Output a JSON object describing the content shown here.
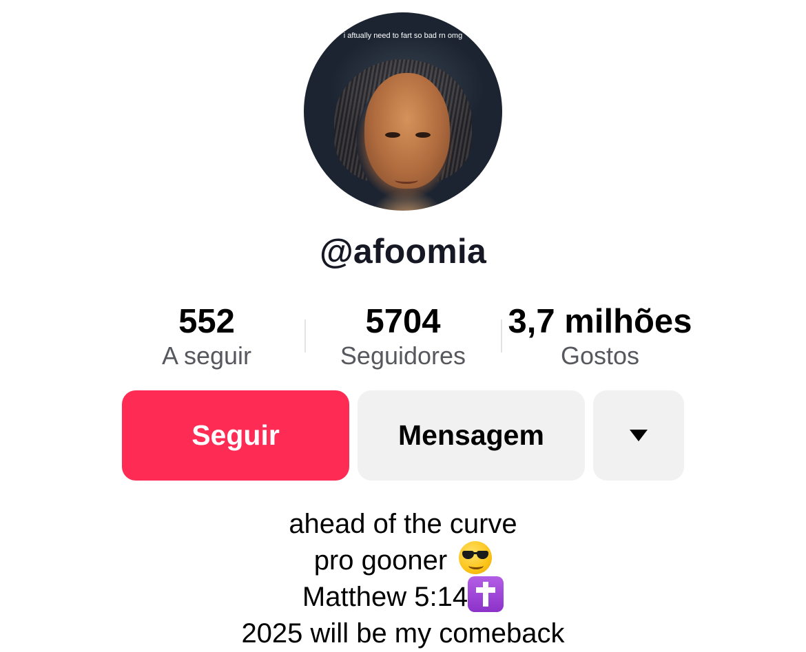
{
  "profile": {
    "avatar_caption": "i aftually need to fart so bad rn omg",
    "username": "@afoomia"
  },
  "stats": [
    {
      "value": "552",
      "label": "A seguir"
    },
    {
      "value": "5704",
      "label": "Seguidores"
    },
    {
      "value": "3,7 milhões",
      "label": "Gostos"
    }
  ],
  "actions": {
    "follow_label": "Seguir",
    "message_label": "Mensagem",
    "more_icon": "caret-down-icon"
  },
  "bio": {
    "line1": "ahead of the curve",
    "line2": "pro gooner",
    "line2_emoji": "sunglasses-face-icon",
    "line3": "Matthew 5:14",
    "line3_emoji": "latin-cross-icon",
    "line4": "2025 will be my comeback"
  },
  "colors": {
    "follow_button": "#fe2c55",
    "secondary_button": "#f1f1f2",
    "label_gray": "#57585e"
  }
}
